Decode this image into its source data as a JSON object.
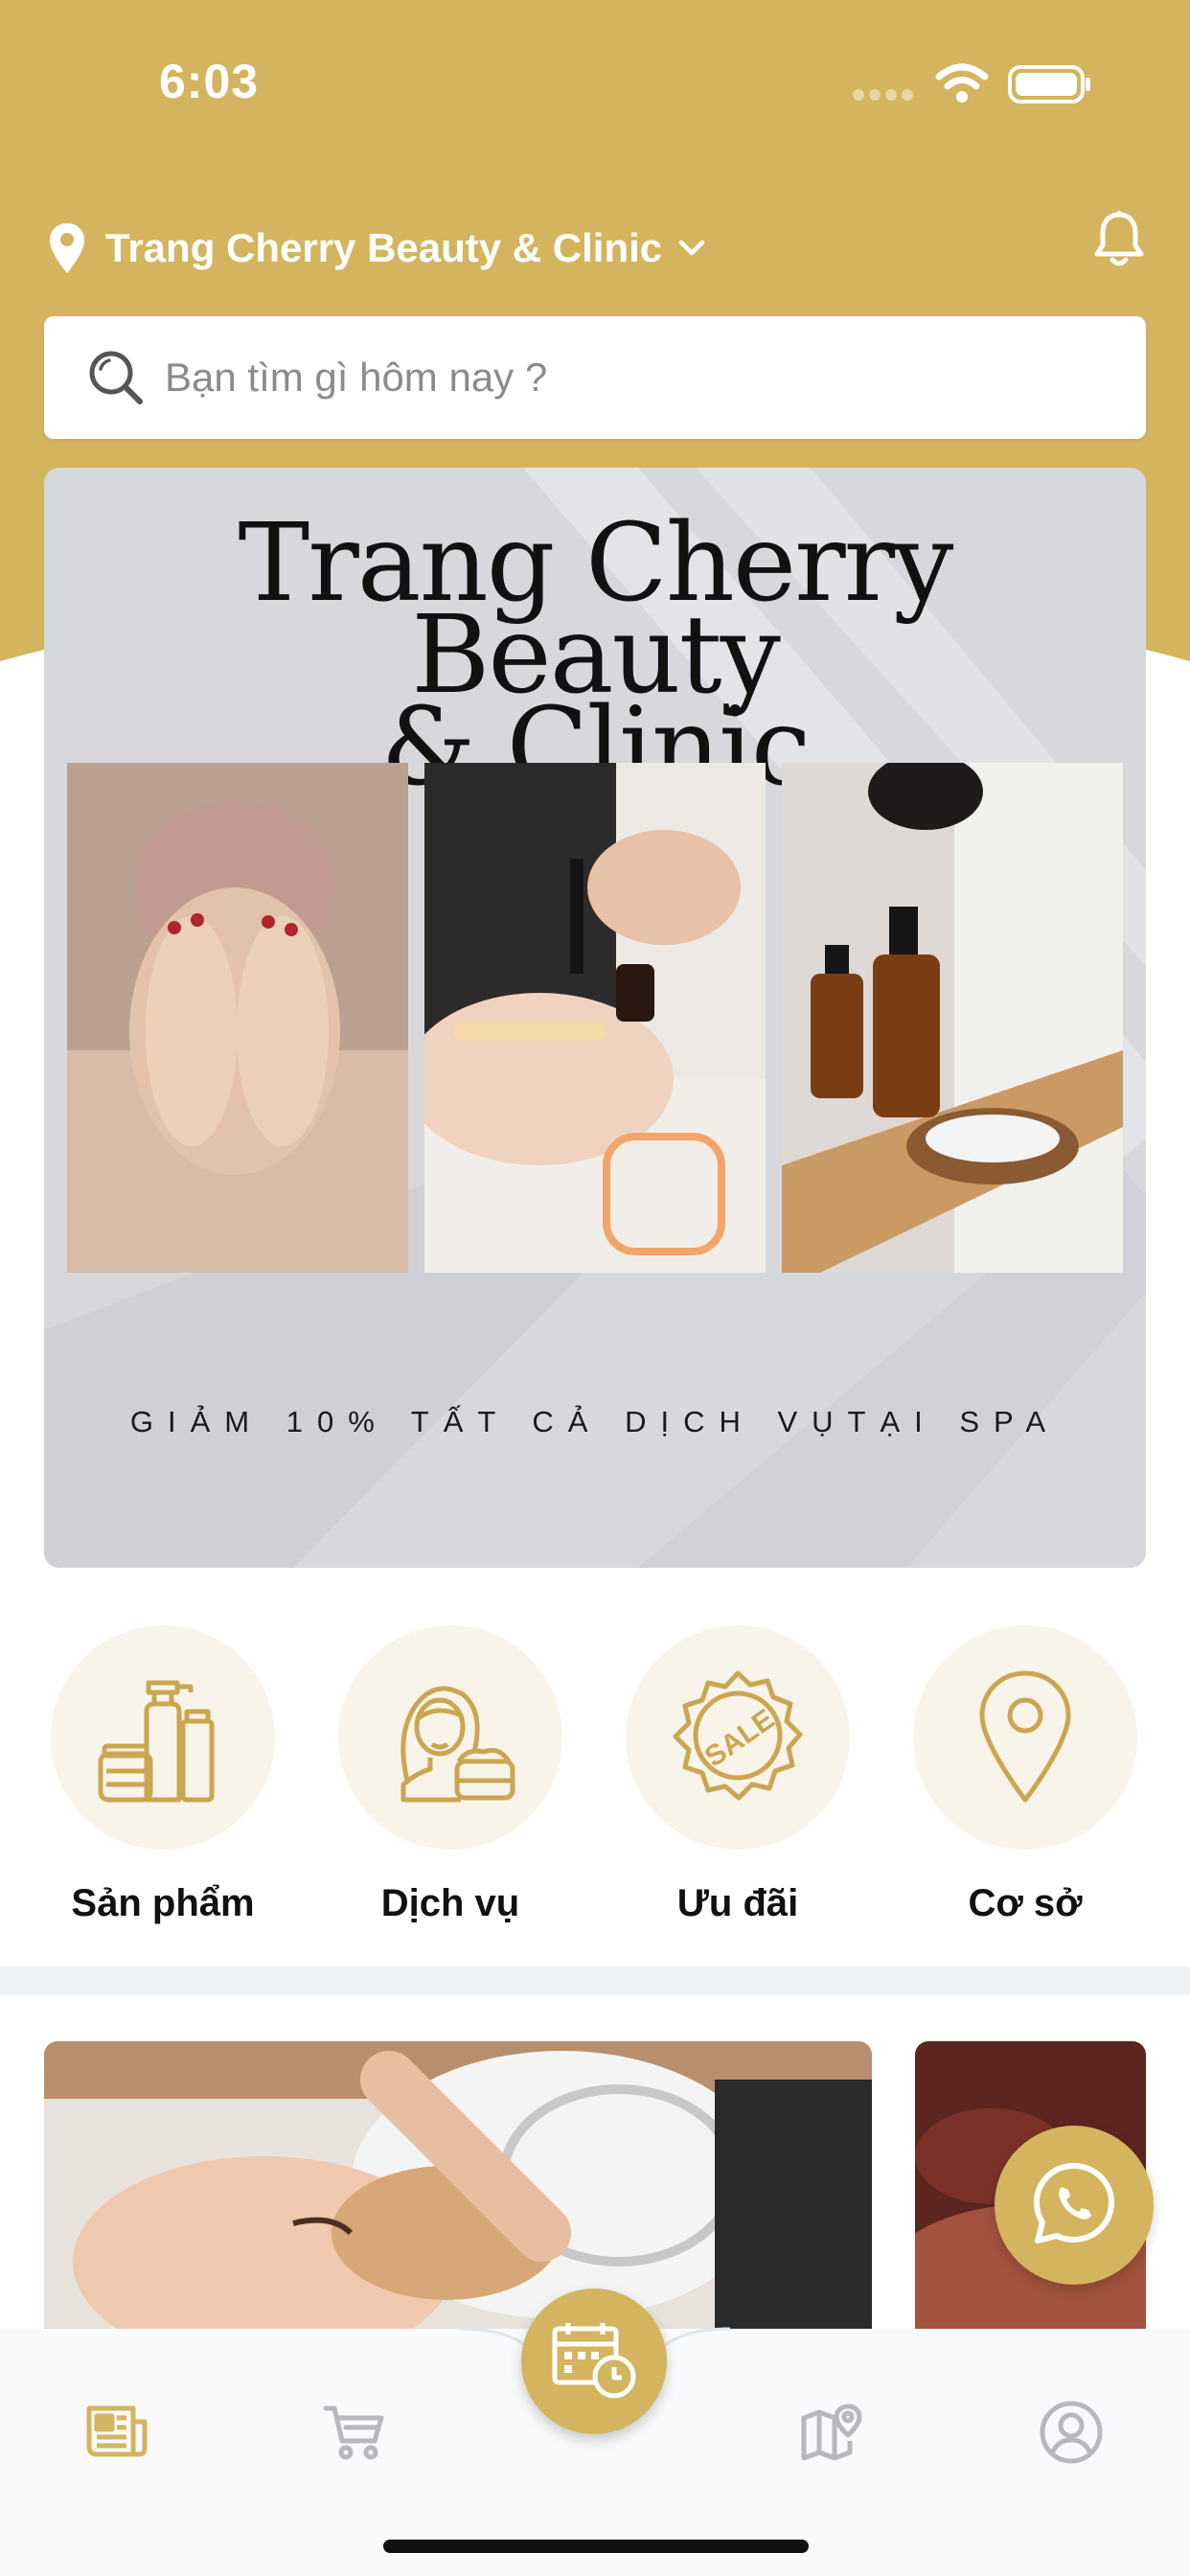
{
  "status_bar": {
    "time": "6:03"
  },
  "header": {
    "location_name": "Trang Cherry Beauty & Clinic",
    "icons": {
      "location": "map-pin-icon",
      "dropdown": "chevron-down-icon",
      "notification": "bell-icon"
    }
  },
  "search": {
    "placeholder": "Bạn tìm gì hôm nay ?",
    "icon": "search-icon"
  },
  "banner": {
    "title_line1": "Trang Cherry Beauty",
    "title_line2": "& Clinic",
    "promo": "GIẢM 10% TẤT CẢ DỊCH VỤTẠI SPA"
  },
  "categories": [
    {
      "label": "Sản phẩm",
      "icon": "cosmetics-bottles-icon"
    },
    {
      "label": "Dịch vụ",
      "icon": "woman-cream-icon"
    },
    {
      "label": "Ưu đãi",
      "icon": "sale-badge-icon"
    },
    {
      "label": "Cơ sở",
      "icon": "map-pin-icon"
    }
  ],
  "floating": {
    "icon": "whatsapp-icon"
  },
  "tabbar": {
    "tabs": [
      {
        "name": "news",
        "icon": "newspaper-icon",
        "active": true
      },
      {
        "name": "cart",
        "icon": "cart-icon",
        "active": false
      },
      {
        "name": "booking",
        "icon": "calendar-clock-icon",
        "active": false
      },
      {
        "name": "map",
        "icon": "map-location-icon",
        "active": false
      },
      {
        "name": "profile",
        "icon": "user-circle-icon",
        "active": false
      }
    ]
  },
  "colors": {
    "brand_gold": "#d4b45e",
    "category_bg": "#f8f4ea",
    "icon_gold": "#cba651",
    "tab_inactive": "#b7b7bd"
  }
}
